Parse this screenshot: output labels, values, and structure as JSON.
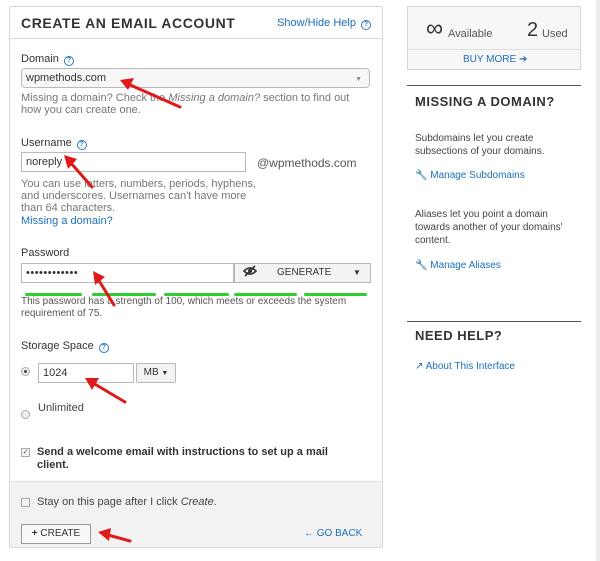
{
  "form": {
    "title": "CREATE AN EMAIL ACCOUNT",
    "help_toggle": "Show/Hide Help",
    "domain": {
      "label": "Domain",
      "value": "wpmethods.com",
      "hint_a": "Missing a domain? Check the ",
      "hint_em": "Missing a domain?",
      "hint_b": " section to find out how you can create one."
    },
    "username": {
      "label": "Username",
      "value": "noreply",
      "suffix": "@wpmethods.com",
      "hint": "You can use letters, numbers, periods, hyphens, and underscores. Usernames can't have more than 64 characters.",
      "link": "Missing a domain?"
    },
    "password": {
      "label": "Password",
      "value": "••••••••••••",
      "generate": "GENERATE",
      "strength_text": "This password has a strength of 100, which meets or exceeds the system requirement of 75."
    },
    "storage": {
      "label": "Storage Space",
      "value": "1024",
      "unit": "MB",
      "unlimited": "Unlimited"
    },
    "welcome_email": "Send a welcome email with instructions to set up a mail client.",
    "stay_a": "Stay on this page after I click ",
    "stay_em": "Create",
    "stay_b": ".",
    "create_button": "CREATE",
    "go_back": "GO BACK"
  },
  "sidebar": {
    "available_symbol": "∞",
    "available_label": "Available",
    "used_count": "2",
    "used_label": "Used",
    "buy_more": "BUY MORE",
    "missing_domain_title": "MISSING A DOMAIN?",
    "subdomains_text": "Subdomains let you create subsections of your domains.",
    "manage_subdomains": "Manage Subdomains",
    "aliases_text": "Aliases let you point a domain towards another of your domains' content.",
    "manage_aliases": "Manage Aliases",
    "need_help_title": "NEED HELP?",
    "about_interface": "About This Interface"
  },
  "colors": {
    "link": "#1e6fb8",
    "strength_bar": "#2fcf2f",
    "annotation_arrow": "#e01a1a"
  }
}
